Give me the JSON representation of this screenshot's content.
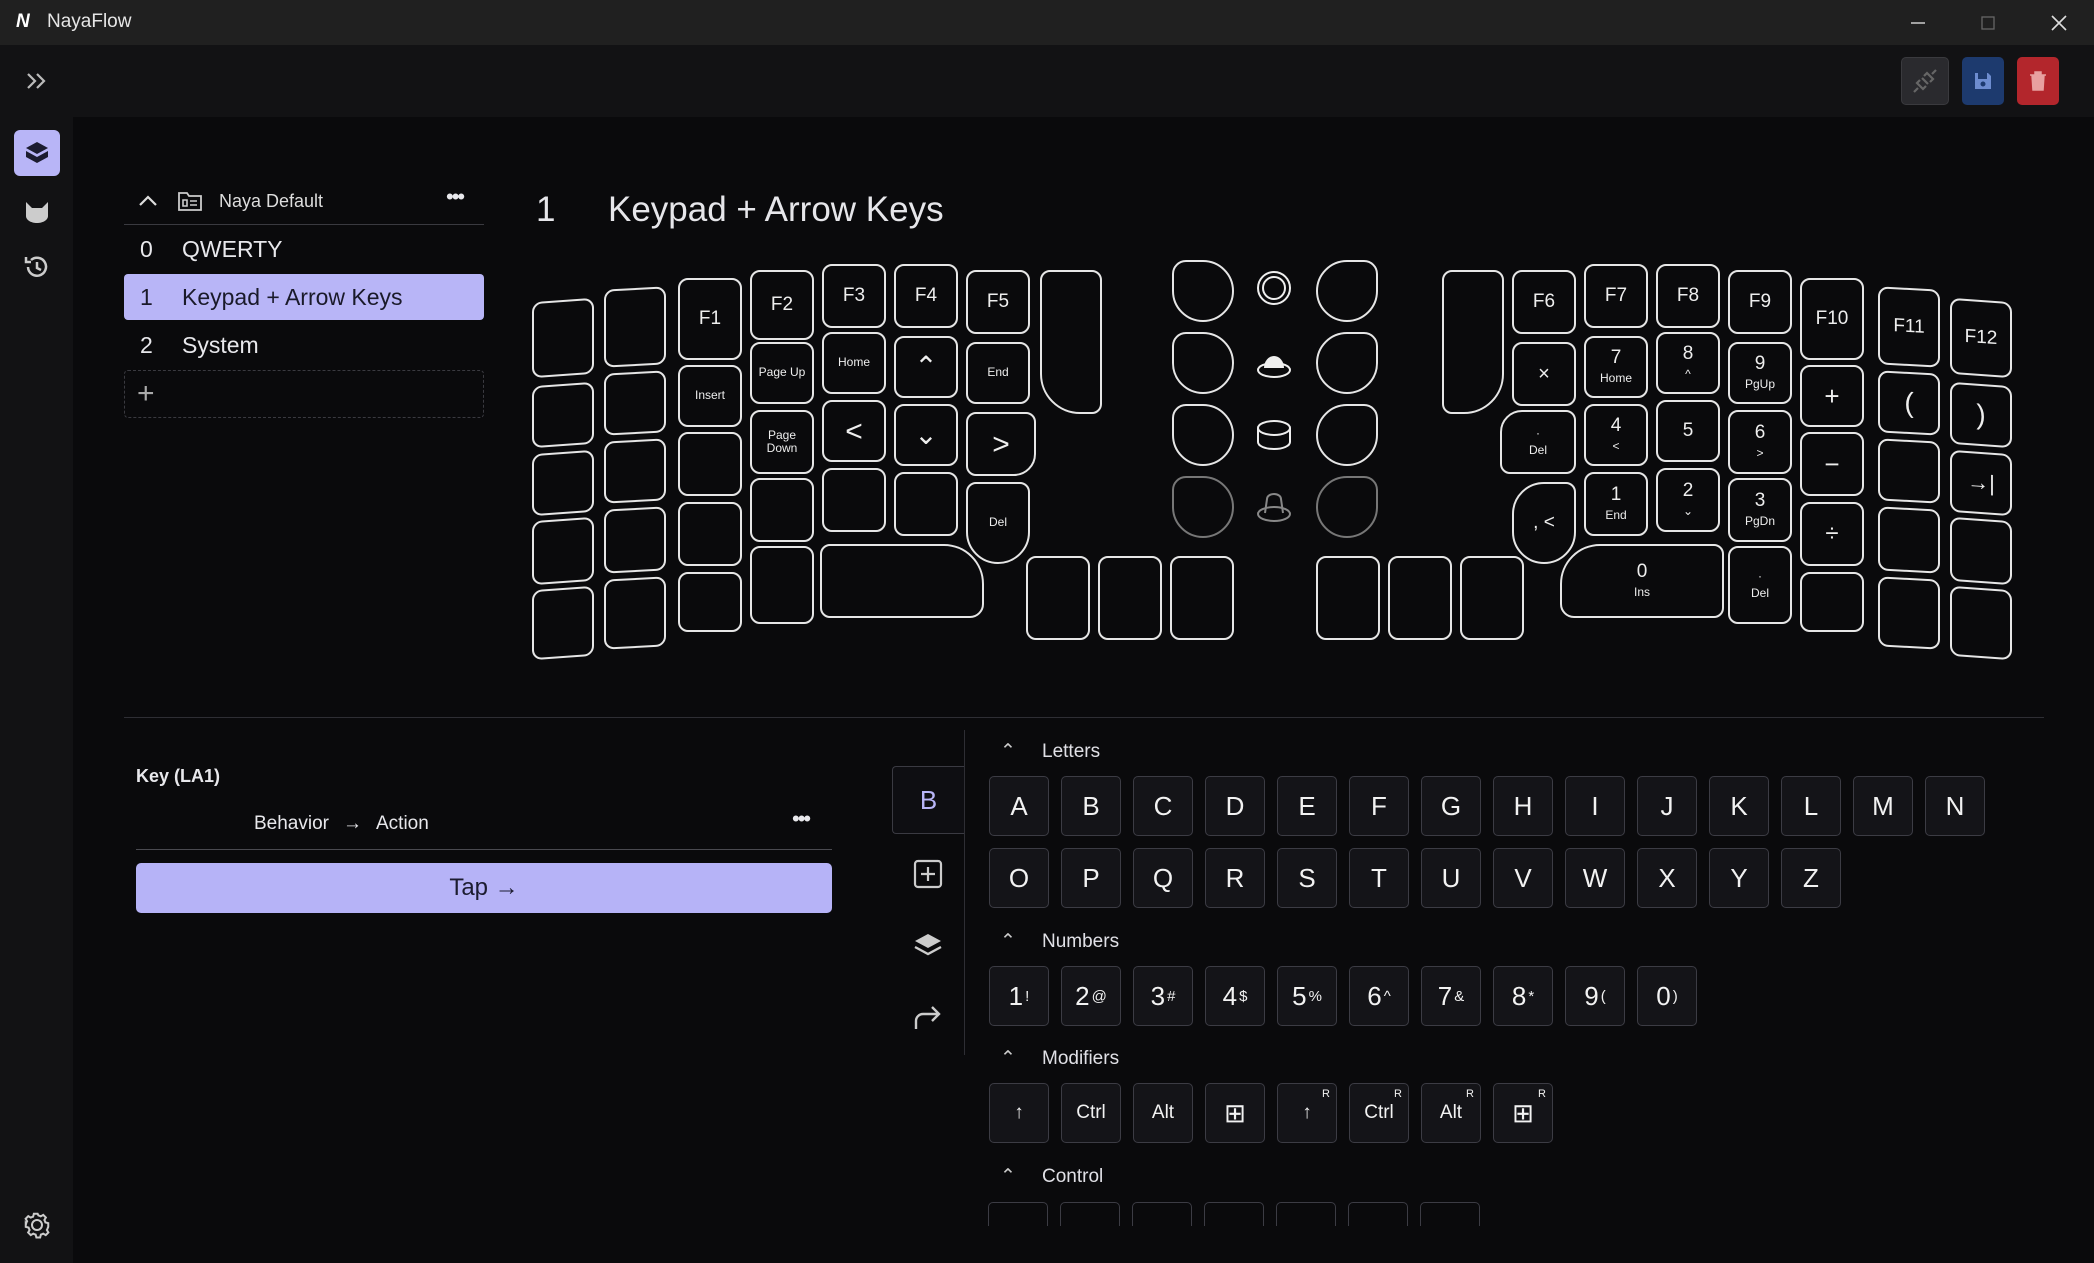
{
  "app": {
    "title": "NayaFlow"
  },
  "window": {
    "minimize_icon": "minimize-icon",
    "maximize_icon": "maximize-icon",
    "close_icon": "close-icon"
  },
  "toolbar": {
    "expand_icon": "double-chevron-right-icon",
    "actions": [
      "unplug-icon",
      "save-icon",
      "trash-icon"
    ]
  },
  "rail": {
    "items": [
      "keyboard-layout-icon",
      "cat-icon",
      "history-icon"
    ],
    "settings_icon": "gear-icon"
  },
  "layer_group": {
    "name": "Naya Default",
    "more": "•••"
  },
  "layers": [
    {
      "num": "0",
      "name": "QWERTY"
    },
    {
      "num": "1",
      "name": "Keypad + Arrow Keys"
    },
    {
      "num": "2",
      "name": "System"
    }
  ],
  "add_layer": "+",
  "heading": {
    "num": "1",
    "title": "Keypad + Arrow Keys"
  },
  "keys": {
    "left": {
      "f1": "F1",
      "f2": "F2",
      "f3": "F3",
      "f4": "F4",
      "f5": "F5",
      "insert": "Insert",
      "page_up": "Page Up",
      "home": "Home",
      "up": "⌃",
      "end": "End",
      "page_down_1": "Page",
      "page_down_2": "Down",
      "left": "<",
      "down": "⌄",
      "right": ">",
      "del": "Del"
    },
    "right": {
      "f6": "F6",
      "f7": "F7",
      "f8": "F8",
      "f9": "F9",
      "f10": "F10",
      "f11": "F11",
      "f12": "F12",
      "mul": "×",
      "k7": "7",
      "k7s": "Home",
      "k8": "8",
      "k8s": "^",
      "k9": "9",
      "k9s": "PgUp",
      "plus": "+",
      "lparen": "(",
      "rparen": ")",
      "dot": "·",
      "dots": "Del",
      "k4": "4",
      "k4s": "<",
      "k5": "5",
      "k6": "6",
      "k6s": ">",
      "minus": "−",
      "tab": "→|",
      "comma": ", <",
      "k1": "1",
      "k1s": "End",
      "k2": "2",
      "k2s": "⌄",
      "k3": "3",
      "k3s": "PgDn",
      "div": "÷",
      "k0": "0",
      "k0s": "Ins",
      "dot2": "·",
      "dot2s": "Del"
    }
  },
  "key_panel": {
    "title": "Key (LA1)",
    "behavior": "Behavior",
    "arrow": "→",
    "action": "Action",
    "more": "•••",
    "tap": "Tap →"
  },
  "side_tabs": {
    "b": "B",
    "add_icon": "plus-square-icon",
    "layers_icon": "layers-icon",
    "redirect_icon": "redirect-icon"
  },
  "sections": {
    "letters": "Letters",
    "numbers": "Numbers",
    "modifiers": "Modifiers",
    "control": "Control"
  },
  "letters_row1": [
    "A",
    "B",
    "C",
    "D",
    "E",
    "F",
    "G",
    "H",
    "I",
    "J",
    "K",
    "L",
    "M",
    "N"
  ],
  "letters_row2": [
    "O",
    "P",
    "Q",
    "R",
    "S",
    "T",
    "U",
    "V",
    "W",
    "X",
    "Y",
    "Z"
  ],
  "numbers": [
    [
      "1",
      "!"
    ],
    [
      "2",
      "@"
    ],
    [
      "3",
      "#"
    ],
    [
      "4",
      "$"
    ],
    [
      "5",
      "%"
    ],
    [
      "6",
      "^"
    ],
    [
      "7",
      "&"
    ],
    [
      "8",
      "*"
    ],
    [
      "9",
      "("
    ],
    [
      "0",
      ")"
    ]
  ],
  "modifiers": [
    {
      "label": "↑",
      "r": ""
    },
    {
      "label": "Ctrl",
      "r": ""
    },
    {
      "label": "Alt",
      "r": ""
    },
    {
      "label": "⊞",
      "r": ""
    },
    {
      "label": "↑",
      "r": "R"
    },
    {
      "label": "Ctrl",
      "r": "R"
    },
    {
      "label": "Alt",
      "r": "R"
    },
    {
      "label": "⊞",
      "r": "R"
    }
  ],
  "colors": {
    "accent": "#b8b5f7",
    "save": "#1d3a6e",
    "delete": "#b3262c",
    "bg": "#0a0a0c"
  }
}
